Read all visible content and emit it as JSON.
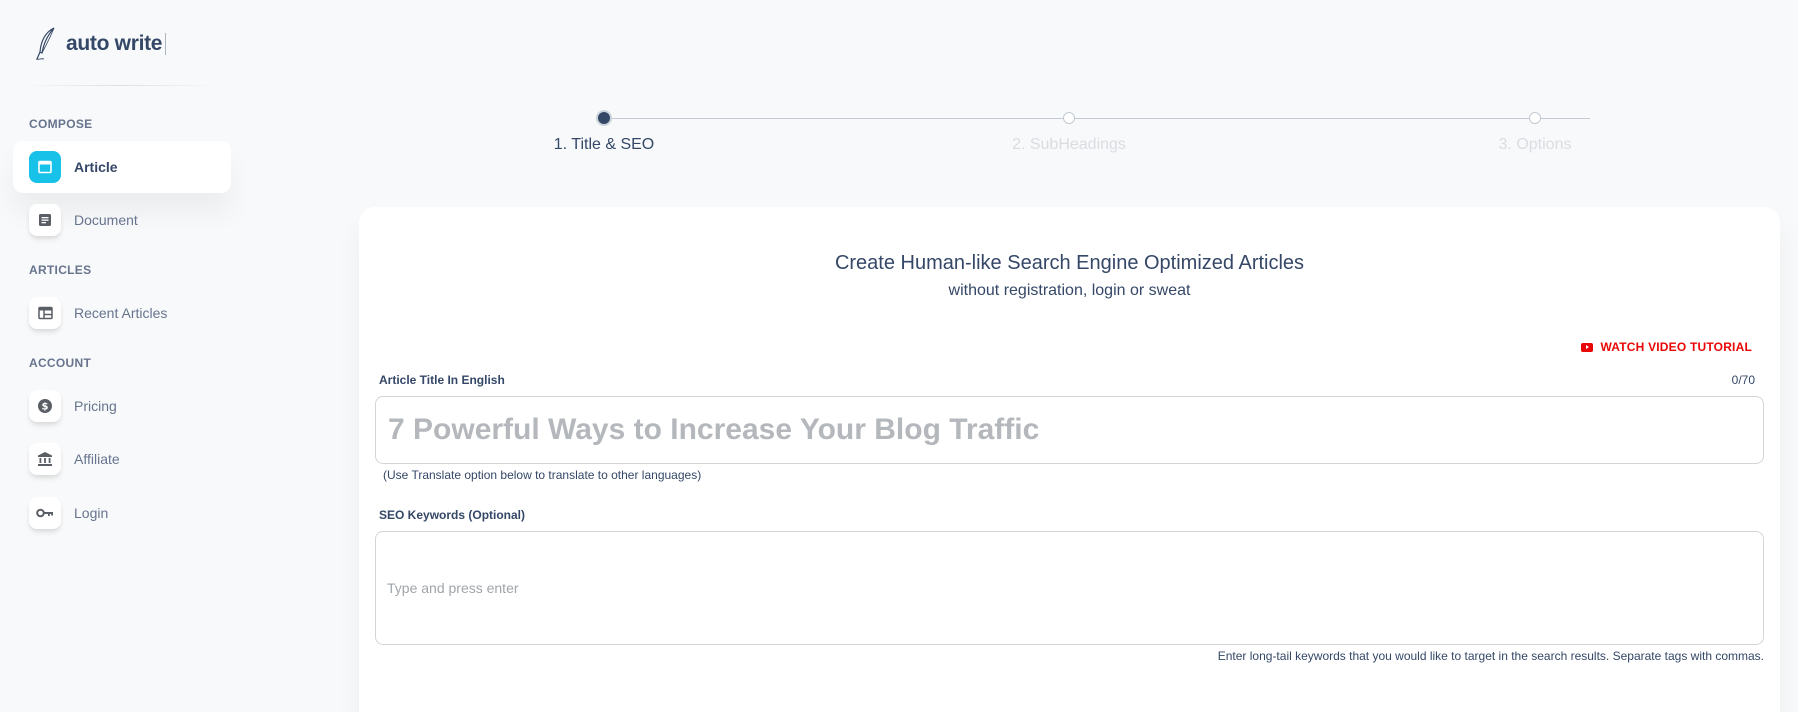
{
  "brand": {
    "name": "auto write"
  },
  "sidebar": {
    "sections": {
      "compose": "COMPOSE",
      "articles": "ARTICLES",
      "account": "ACCOUNT"
    },
    "items": [
      {
        "label": "Article",
        "icon": "window-icon",
        "active": true
      },
      {
        "label": "Document",
        "icon": "document-icon"
      },
      {
        "label": "Recent Articles",
        "icon": "table-icon"
      },
      {
        "label": "Pricing",
        "icon": "dollar-icon"
      },
      {
        "label": "Affiliate",
        "icon": "bank-icon"
      },
      {
        "label": "Login",
        "icon": "key-icon"
      }
    ]
  },
  "stepper": {
    "steps": [
      {
        "label": "1. Title & SEO",
        "active": true
      },
      {
        "label": "2. SubHeadings"
      },
      {
        "label": "3. Options"
      }
    ]
  },
  "card": {
    "title": "Create Human-like Search Engine Optimized Articles",
    "subtitle": "without registration, login or sweat",
    "video_link": "WATCH VIDEO TUTORIAL",
    "title_field": {
      "label": "Article Title In English",
      "counter": "0/70",
      "placeholder": "7 Powerful Ways to Increase Your Blog Traffic",
      "value": "",
      "hint": "(Use Translate option below to translate to other languages)"
    },
    "keywords_field": {
      "label": "SEO Keywords (Optional)",
      "placeholder": "Type and press enter",
      "help": "Enter long-tail keywords that you would like to target in the search results. Separate tags with commas."
    }
  },
  "colors": {
    "accent": "#17c1e8",
    "text": "#344767",
    "muted": "#67748e",
    "danger": "#ea0606",
    "background": "#f8f9fa"
  }
}
